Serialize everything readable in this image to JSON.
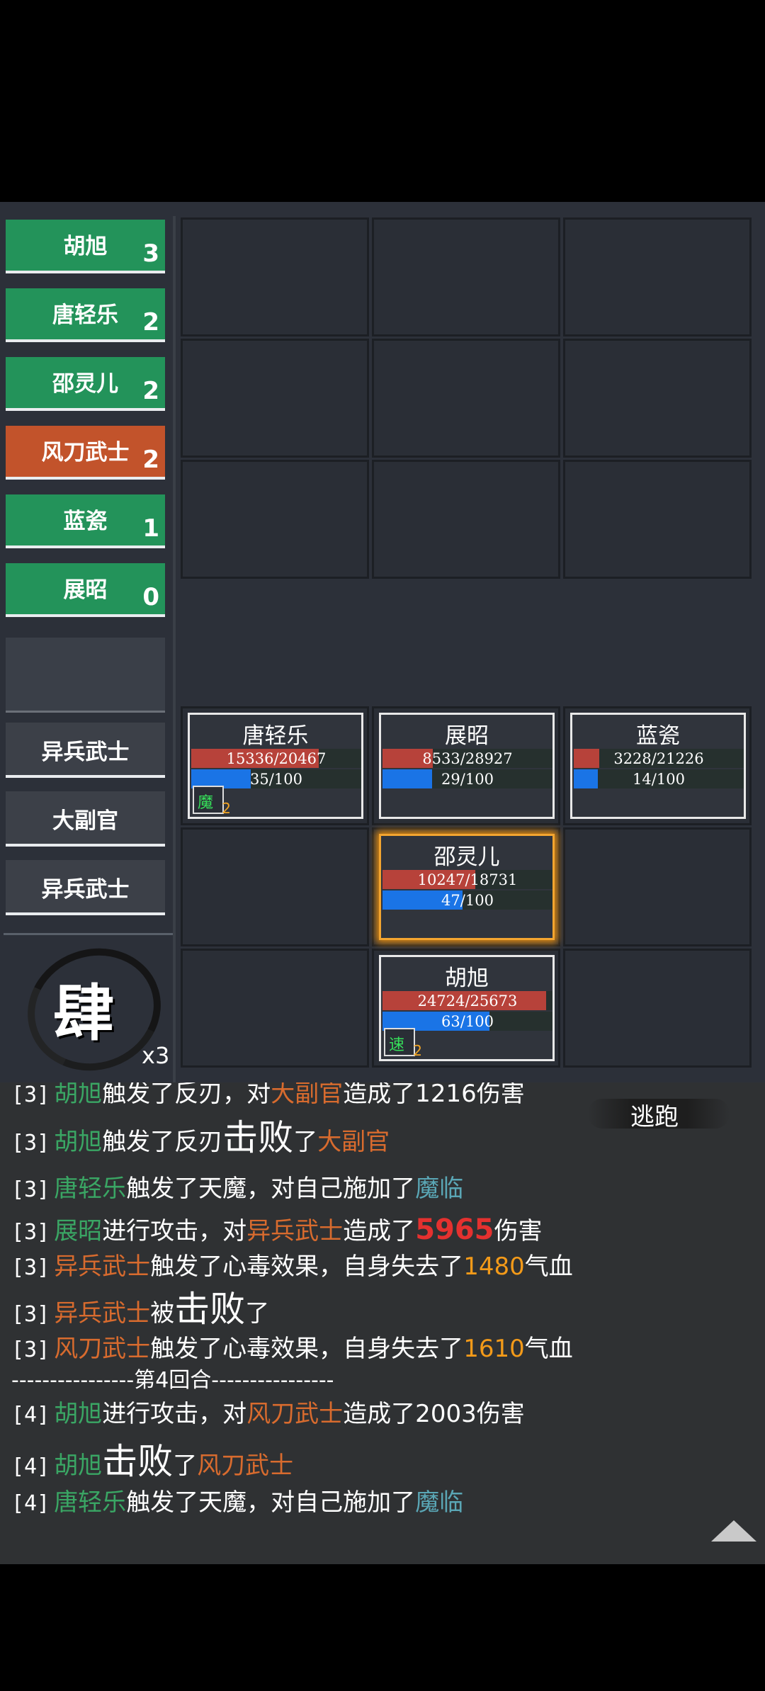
{
  "turn_order": [
    {
      "name": "胡旭",
      "count": "3",
      "color": "#23935a"
    },
    {
      "name": "唐轻乐",
      "count": "2",
      "color": "#23935a"
    },
    {
      "name": "邵灵儿",
      "count": "2",
      "color": "#23935a"
    },
    {
      "name": "风刀武士",
      "count": "2",
      "color": "#c2532b"
    },
    {
      "name": "蓝瓷",
      "count": "1",
      "color": "#23935a"
    },
    {
      "name": "展昭",
      "count": "0",
      "color": "#23935a"
    }
  ],
  "enemies": [
    "异兵武士",
    "大副官",
    "异兵武士"
  ],
  "emblem": {
    "glyph": "肆",
    "multiplier": "x3"
  },
  "units": {
    "tang": {
      "name": "唐轻乐",
      "hp": "15336/20467",
      "hp_frac": 0.749,
      "mp": "35/100",
      "mp_frac": 0.35,
      "badge": "魔",
      "badge_num": "2"
    },
    "zhan": {
      "name": "展昭",
      "hp": "8533/28927",
      "hp_frac": 0.295,
      "mp": "29/100",
      "mp_frac": 0.29
    },
    "lan": {
      "name": "蓝瓷",
      "hp": "3228/21226",
      "hp_frac": 0.152,
      "mp": "14/100",
      "mp_frac": 0.14
    },
    "shao": {
      "name": "邵灵儿",
      "hp": "10247/18731",
      "hp_frac": 0.547,
      "mp": "47/100",
      "mp_frac": 0.47
    },
    "hu": {
      "name": "胡旭",
      "hp": "24724/25673",
      "hp_frac": 0.963,
      "mp": "63/100",
      "mp_frac": 0.63,
      "badge": "速",
      "badge_num": "2"
    }
  },
  "escape_label": "逃跑",
  "log": {
    "l0": {
      "tag": "[3]",
      "a": "胡旭",
      "b": "触发了反刃，对",
      "c": "大副官",
      "d": "造成了1216伤害"
    },
    "l1": {
      "tag": "[3]",
      "a": "胡旭",
      "b": "触发了反刃",
      "big": "击败",
      "c": "了",
      "d": "大副官"
    },
    "l2": {
      "tag": "[3]",
      "a": "唐轻乐",
      "b": "触发了天魔，对自己施加了",
      "c": "魔临"
    },
    "l3": {
      "tag": "[3]",
      "a": "展昭",
      "b": "进行攻击，对",
      "c": "异兵武士",
      "d": "造成了",
      "e": "5965",
      "f": "伤害"
    },
    "l4": {
      "tag": "[3]",
      "a": "异兵武士",
      "b": "触发了心毒效果，自身失去了",
      "c": "1480",
      "d": "气血"
    },
    "l5": {
      "tag": "[3]",
      "a": "异兵武士",
      "b": "被",
      "big": "击败",
      "c": "了"
    },
    "l6": {
      "tag": "[3]",
      "a": "风刀武士",
      "b": "触发了心毒效果，自身失去了",
      "c": "1610",
      "d": "气血"
    },
    "divider": "----------------第4回合----------------",
    "l7": {
      "tag": "[4]",
      "a": "胡旭",
      "b": "进行攻击，对",
      "c": "风刀武士",
      "d": "造成了2003伤害"
    },
    "l8": {
      "tag": "[4]",
      "a": "胡旭",
      "big": "击败",
      "b": "了",
      "c": "风刀武士"
    },
    "l9": {
      "tag": "[4]",
      "a": "唐轻乐",
      "b": "触发了天魔，对自己施加了",
      "c": "魔临"
    }
  }
}
